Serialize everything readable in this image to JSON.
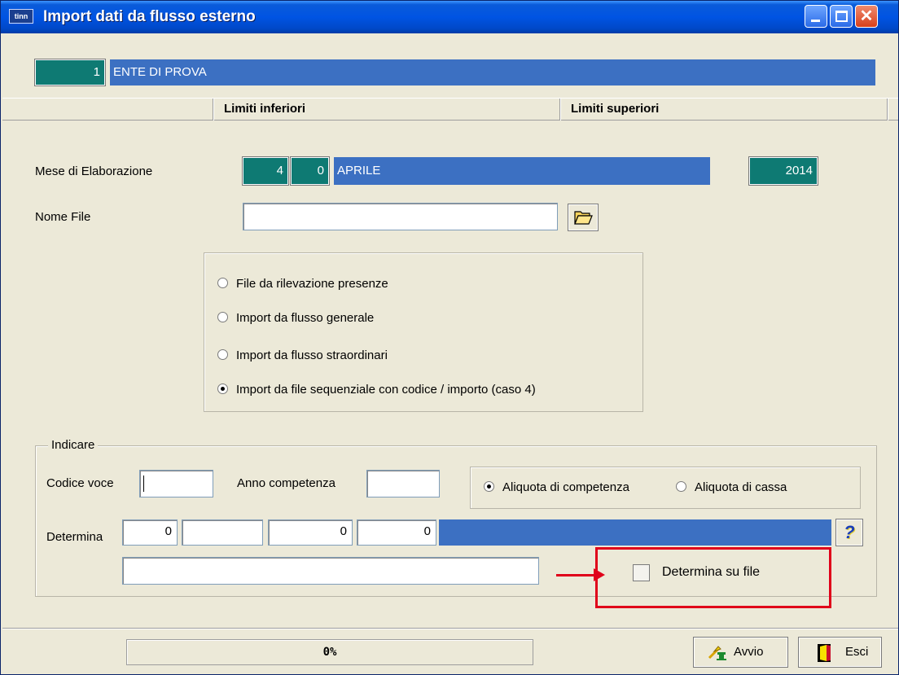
{
  "titlebar": {
    "app_icon": "tinn",
    "title": "Import dati da flusso esterno"
  },
  "ente": {
    "code": "1",
    "name": "ENTE DI PROVA"
  },
  "headers": {
    "lower": "Limiti inferiori",
    "upper": "Limiti superiori"
  },
  "mese": {
    "label": "Mese di Elaborazione",
    "month_num": "4",
    "sub": "0",
    "month_name": "APRILE",
    "year": "2014"
  },
  "file": {
    "label": "Nome File",
    "value": ""
  },
  "options": [
    {
      "label": "File da rilevazione presenze",
      "selected": false
    },
    {
      "label": "Import da flusso generale",
      "selected": false
    },
    {
      "label": "Import da flusso straordinari",
      "selected": false
    },
    {
      "label": "Import da file sequenziale con codice / importo (caso 4)",
      "selected": true
    }
  ],
  "indicare": {
    "legend": "Indicare",
    "codice_voce_label": "Codice voce",
    "codice_voce_value": "",
    "anno_label": "Anno competenza",
    "anno_value": "",
    "aliquota_competenza": "Aliquota di competenza",
    "aliquota_cassa": "Aliquota di cassa",
    "aliquota_selected": "competenza",
    "determina_label": "Determina",
    "determina_values": [
      "0",
      "",
      "0",
      "0"
    ],
    "determina_desc": "",
    "help_glyph": "?",
    "determina_file_label": "Determina su file",
    "determina_file_checked": false
  },
  "status": {
    "progress": "0%",
    "progress_value": 0
  },
  "buttons": {
    "avvio": "Avvio",
    "esci": "Esci"
  },
  "colors": {
    "teal": "#0e7a73",
    "blue": "#3c70c2",
    "highlight": "#e0001a",
    "window_bg": "#ece9d8"
  }
}
